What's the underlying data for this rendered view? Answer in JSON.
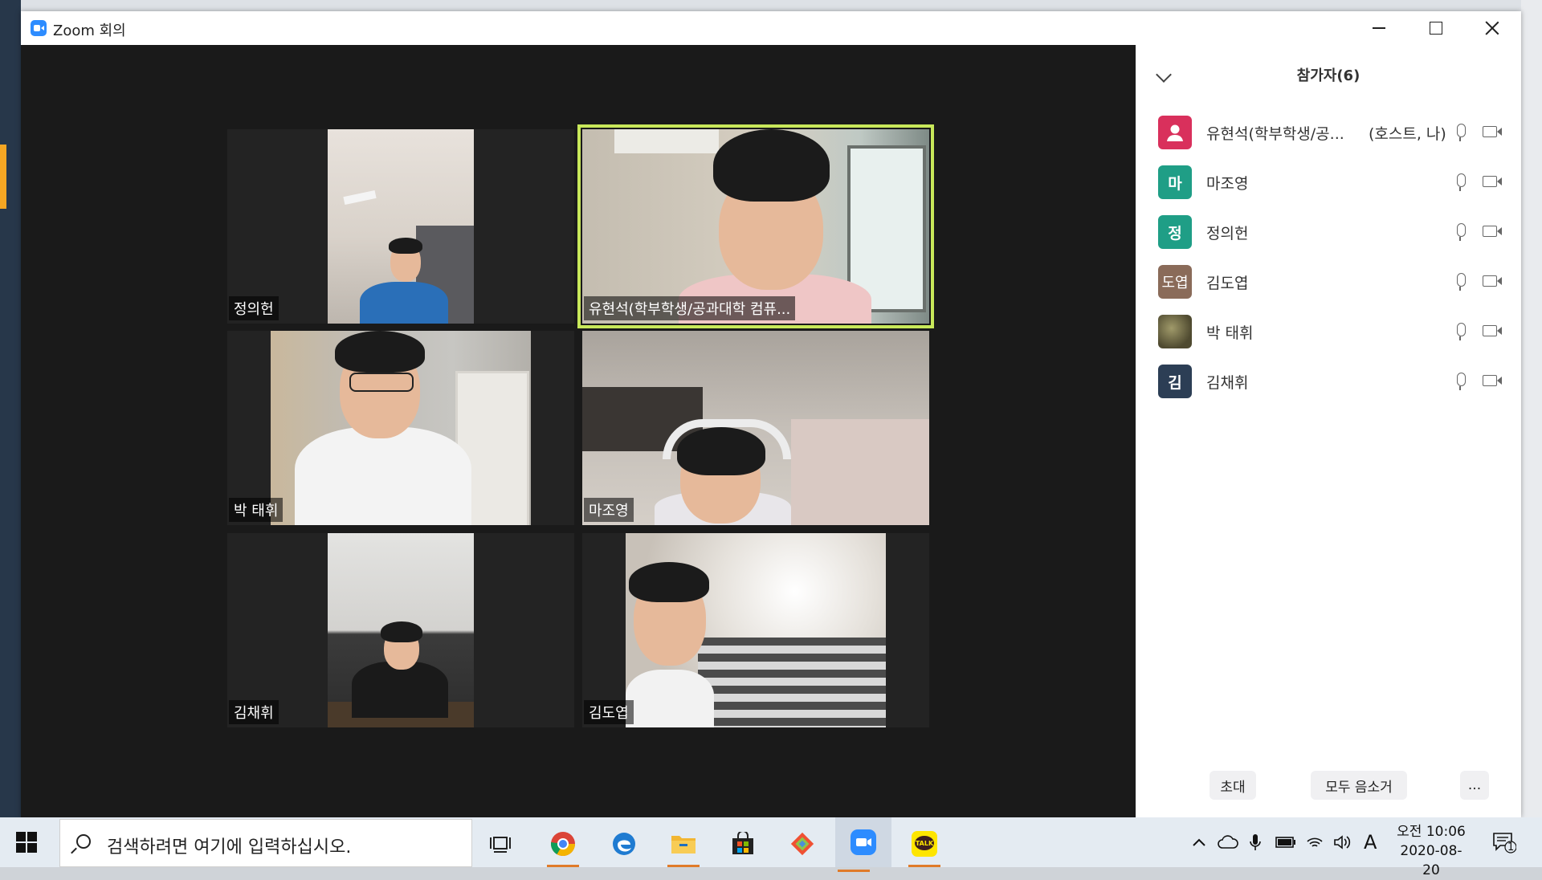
{
  "window": {
    "title": "Zoom 회의",
    "controls": {
      "minimize": "minimize",
      "maximize": "maximize",
      "close": "close"
    }
  },
  "video_tiles": [
    {
      "name": "정의헌",
      "active": false
    },
    {
      "name": "유현석(학부학생/공과대학 컴퓨...",
      "active": true
    },
    {
      "name": "박 태휘",
      "active": false
    },
    {
      "name": "마조영",
      "active": false
    },
    {
      "name": "김채휘",
      "active": false
    },
    {
      "name": "김도엽",
      "active": false
    }
  ],
  "participants_panel": {
    "title": "참가자(6)",
    "participants": [
      {
        "avatar_text": "",
        "avatar_color": "#d9305c",
        "name": "유현석(학부학생/공...",
        "role": "(호스트, 나)"
      },
      {
        "avatar_text": "마",
        "avatar_color": "#1f9e86",
        "name": "마조영",
        "role": ""
      },
      {
        "avatar_text": "정",
        "avatar_color": "#1f9e86",
        "name": "정의헌",
        "role": ""
      },
      {
        "avatar_text": "도엽",
        "avatar_color": "#8a6b59",
        "name": "김도엽",
        "role": ""
      },
      {
        "avatar_text": "",
        "avatar_color": "#6f6a4a",
        "name": "박 태휘",
        "role": ""
      },
      {
        "avatar_text": "김",
        "avatar_color": "#2c3e55",
        "name": "김채휘",
        "role": ""
      }
    ],
    "buttons": {
      "invite": "초대",
      "mute_all": "모두 음소거",
      "more": "..."
    }
  },
  "taskbar": {
    "search_placeholder": "검색하려면 여기에 입력하십시오.",
    "apps": [
      "task-view",
      "chrome",
      "edge",
      "file-explorer",
      "store",
      "git",
      "zoom",
      "kakaotalk"
    ],
    "ime": "A",
    "time_period": "오전",
    "time": "10:06",
    "date": "2020-08-20",
    "notification_count": "1"
  }
}
